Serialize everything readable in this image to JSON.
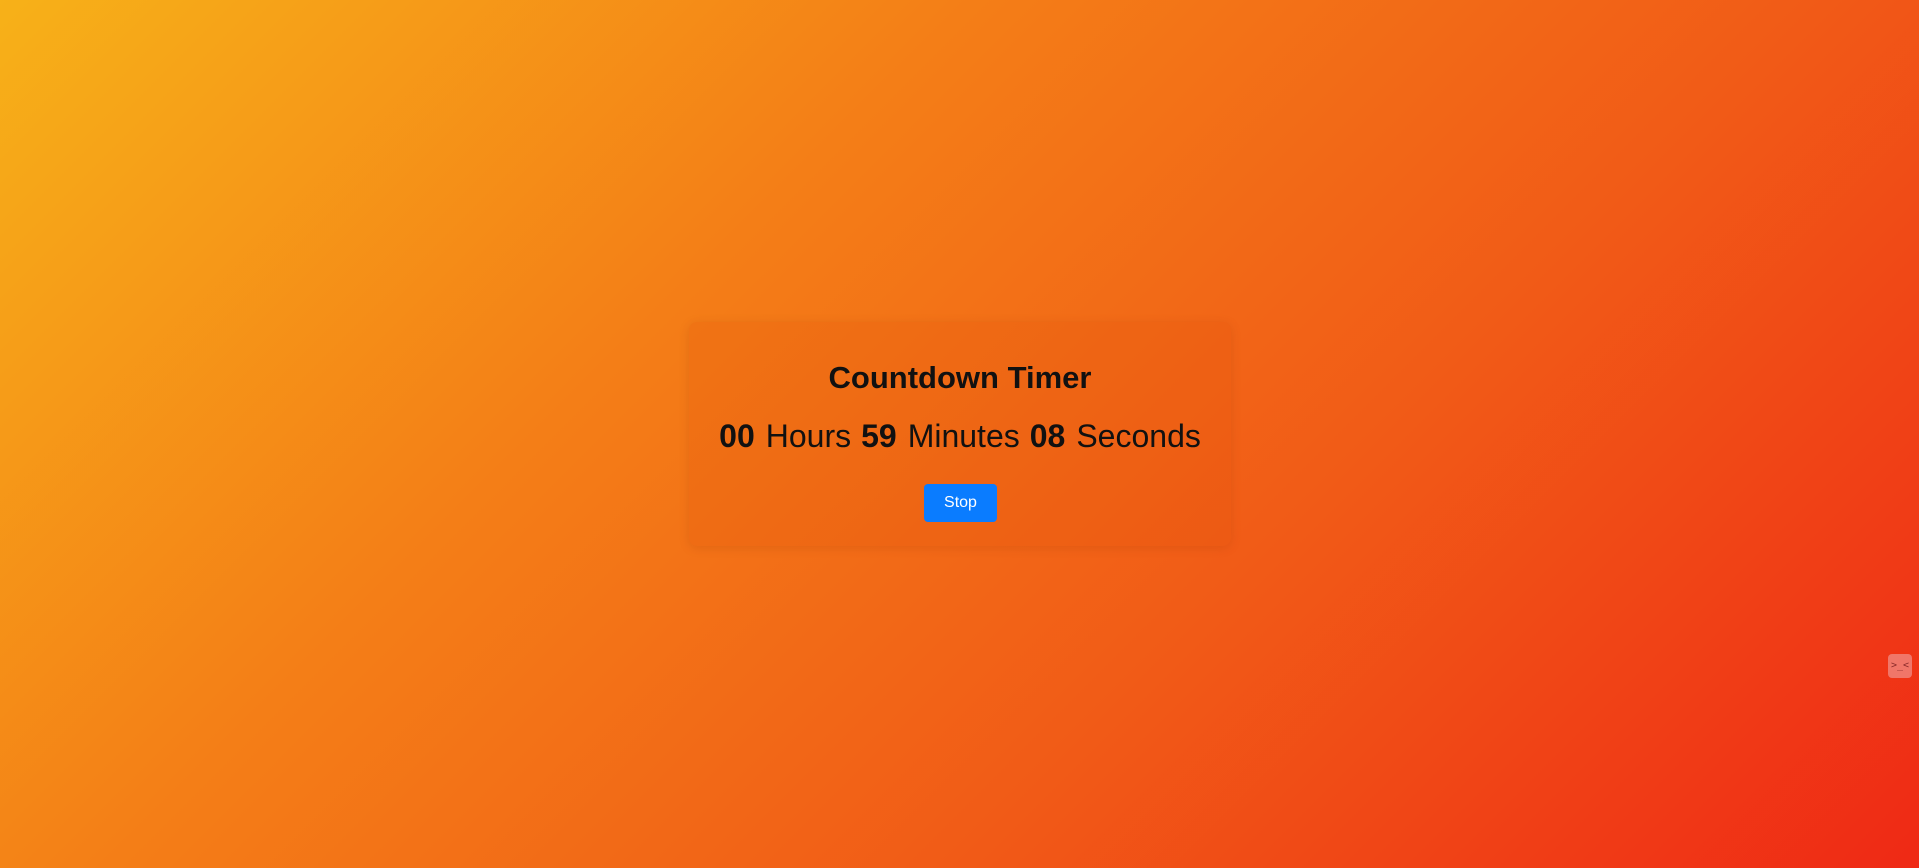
{
  "timer": {
    "title": "Countdown Timer",
    "hours": "00",
    "hours_label": "Hours",
    "minutes": "59",
    "minutes_label": "Minutes",
    "seconds": "08",
    "seconds_label": "Seconds",
    "stop_label": "Stop"
  },
  "side_widget": {
    "icon": "angry-face-icon"
  },
  "colors": {
    "gradient_start": "#f7b118",
    "gradient_end": "#ef2915",
    "button": "#0a7cff"
  }
}
